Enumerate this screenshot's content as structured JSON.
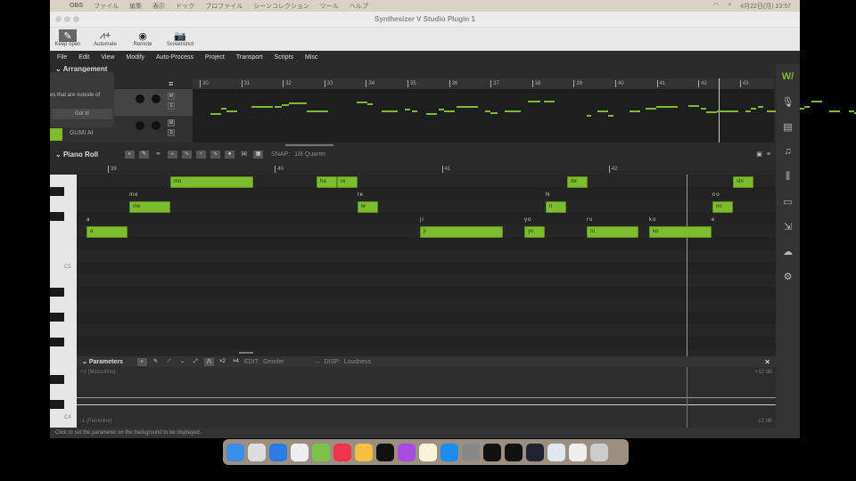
{
  "menubar": {
    "app": "OBS",
    "items": [
      "ファイル",
      "編集",
      "表示",
      "ドック",
      "プロファイル",
      "シーンコレクション",
      "ツール",
      "ヘルプ"
    ],
    "clock": "4月22日(月)  23:57"
  },
  "window": {
    "title": "Synthesizer V Studio Plugin 1"
  },
  "toolbar": [
    {
      "label": "Keep open",
      "icon": "pin-icon"
    },
    {
      "label": "Automate",
      "icon": "automate-icon"
    },
    {
      "label": "Remote",
      "icon": "remote-icon"
    },
    {
      "label": "Screenshot",
      "icon": "camera-icon"
    }
  ],
  "menu": [
    "File",
    "Edit",
    "View",
    "Modify",
    "Auto-Process",
    "Project",
    "Transport",
    "Scripts",
    "Misc"
  ],
  "arrangement": {
    "title": "Arrangement",
    "bars": [
      "30",
      "31",
      "32",
      "33",
      "34",
      "35",
      "36",
      "37",
      "38",
      "39",
      "40",
      "41",
      "42",
      "43"
    ],
    "track2": "GUMI AI",
    "mute": "M",
    "solo": "S"
  },
  "popup": {
    "text": "es that are outside of",
    "button": "Got it!"
  },
  "piano_roll": {
    "title": "Piano Roll",
    "snap_label": "SNAP:",
    "snap_value": "1/8 Quarter",
    "bars": [
      "39",
      "40",
      "41",
      "42"
    ],
    "keys": [
      "C5",
      "C4"
    ],
    "notes": [
      {
        "lyric": "a",
        "phoneme": "a"
      },
      {
        "lyric": "me",
        "phoneme": "me"
      },
      {
        "lyric": "mo",
        "phoneme": "mo"
      },
      {
        "lyric": "ha",
        "phoneme": "ha"
      },
      {
        "lyric": "re",
        "phoneme": "re"
      },
      {
        "lyric": "te",
        "phoneme": "te"
      },
      {
        "lyric": "ji",
        "phoneme": "ji"
      },
      {
        "lyric": "yo",
        "phoneme": "yo"
      },
      {
        "lyric": "N",
        "phoneme": "n"
      },
      {
        "lyric": "de",
        "phoneme": "de"
      },
      {
        "lyric": "ru",
        "phoneme": "ru"
      },
      {
        "lyric": "ko",
        "phoneme": "ko"
      },
      {
        "lyric": "e",
        "phoneme": ""
      },
      {
        "lyric": "no",
        "phoneme": "no"
      },
      {
        "lyric": "shi",
        "phoneme": "shi"
      },
      {
        "lyric": "te",
        "phoneme": "te"
      }
    ]
  },
  "parameters": {
    "title": "Parameters",
    "edit_label": "EDIT:",
    "edit_value": "Gender",
    "disp_label": "DISP:",
    "disp_value": "Loudness",
    "top_left": "+1 (Masculine)",
    "bottom_left": "-1 (Feminine)",
    "top_right": "+12 dB",
    "bottom_right": "-12 dB",
    "close": "✕"
  },
  "status": "Click to set the parameter on the background to be displayed.",
  "accent": "#7dbb2f"
}
